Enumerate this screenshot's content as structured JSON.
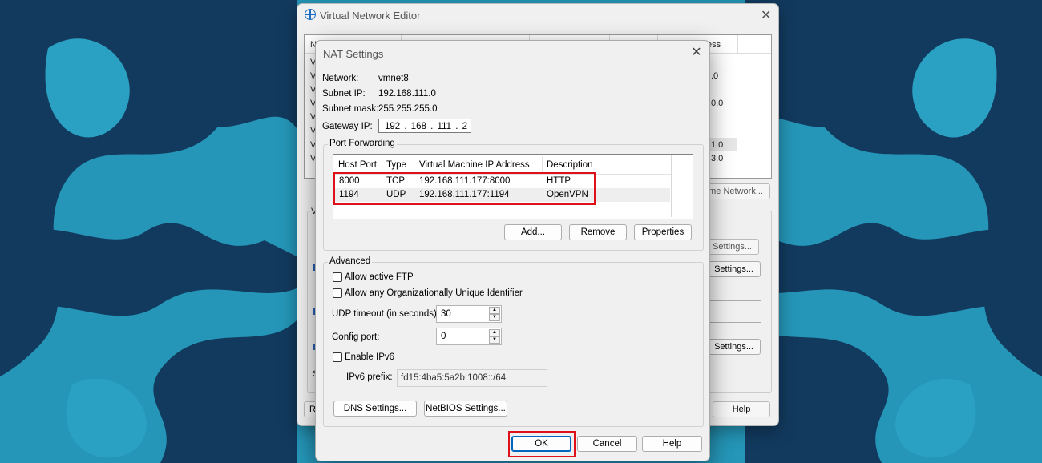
{
  "colors": {
    "accent": "#0067c0",
    "highlight": "#e0101a",
    "background": "#1f8fb0",
    "background_dark": "#123a5e"
  },
  "back_window": {
    "title": "Virtual Network Editor",
    "title_icon": "globe-icon",
    "list_header_tail": "ess",
    "list_first_col_header": "N",
    "list_row_prefixes": [
      "V",
      "V",
      "V",
      "V",
      "V",
      "V",
      "V",
      "V"
    ],
    "list_values_right": [
      ".0",
      "0.0",
      "1.0",
      "3.0"
    ],
    "rename_network_button": "me Network...",
    "dhcp_settings_button": "c Settings...",
    "nat_settings_button": "Settings...",
    "dhcp2_settings_button": "Settings...",
    "help_button": "Help",
    "left_cutoff_r": "R",
    "left_cutoff_v": "V",
    "left_cutoff_s": "S"
  },
  "dialog": {
    "title": "NAT Settings",
    "network_label": "Network:",
    "network_value": "vmnet8",
    "subnet_ip_label": "Subnet IP:",
    "subnet_ip_value": "192.168.111.0",
    "subnet_mask_label": "Subnet mask:",
    "subnet_mask_value": "255.255.255.0",
    "gateway_label": "Gateway IP:",
    "gateway_value": "192 . 168 . 111 .  2",
    "port_forwarding": {
      "group_label": "Port Forwarding",
      "headers": [
        "Host Port",
        "Type",
        "Virtual Machine IP Address",
        "Description"
      ],
      "rows": [
        {
          "host_port": "8000",
          "type": "TCP",
          "vm_ip": "192.168.111.177:8000",
          "description": "HTTP"
        },
        {
          "host_port": "1194",
          "type": "UDP",
          "vm_ip": "192.168.111.177:1194",
          "description": "OpenVPN"
        }
      ],
      "add_button": "Add...",
      "remove_button": "Remove",
      "properties_button": "Properties"
    },
    "advanced": {
      "group_label": "Advanced",
      "allow_ftp_label": "Allow active FTP",
      "allow_oui_label": "Allow any Organizationally Unique Identifier",
      "udp_timeout_label": "UDP timeout (in seconds):",
      "udp_timeout_value": "30",
      "config_port_label": "Config port:",
      "config_port_value": "0",
      "enable_ipv6_label": "Enable IPv6",
      "ipv6_prefix_label": "IPv6 prefix:",
      "ipv6_prefix_value": "fd15:4ba5:5a2b:1008::/64",
      "dns_button": "DNS Settings...",
      "netbios_button": "NetBIOS Settings..."
    },
    "ok_button": "OK",
    "cancel_button": "Cancel",
    "help_button": "Help"
  }
}
